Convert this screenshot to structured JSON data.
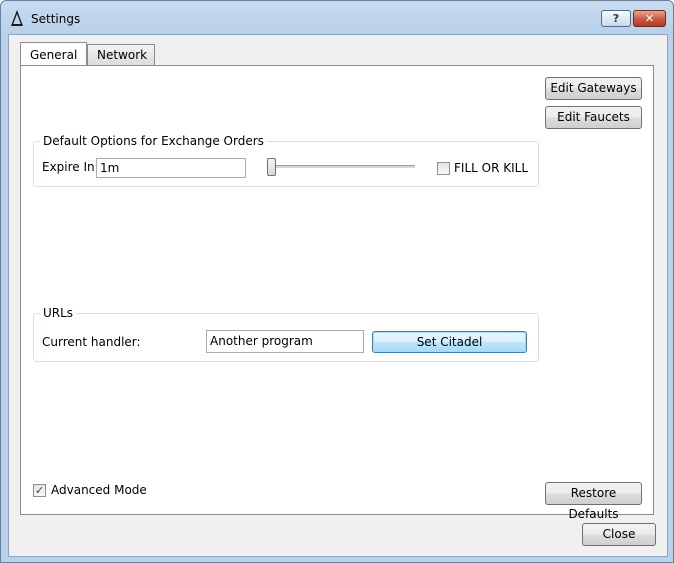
{
  "window": {
    "title": "Settings",
    "help_label": "?",
    "close_glyph": "✕",
    "app_icon": "delta-icon"
  },
  "tabs": [
    {
      "label": "General",
      "active": true
    },
    {
      "label": "Network",
      "active": false
    }
  ],
  "general": {
    "edit_gateways_label": "Edit Gateways",
    "edit_faucets_label": "Edit Faucets",
    "exchange_group": {
      "title": "Default Options for Exchange Orders",
      "expire_label": "Expire In",
      "expire_value": "1m",
      "expire_slider_position": 0,
      "fill_or_kill_label": "FILL OR KILL",
      "fill_or_kill_checked": false
    },
    "urls_group": {
      "title": "URLs",
      "handler_label": "Current handler:",
      "handler_value": "Another program",
      "set_button_label": "Set Citadel"
    },
    "advanced_mode_label": "Advanced Mode",
    "advanced_mode_checked": true,
    "advanced_mode_mark": "✓",
    "restore_defaults_label": "Restore Defaults"
  },
  "footer": {
    "close_label": "Close"
  }
}
